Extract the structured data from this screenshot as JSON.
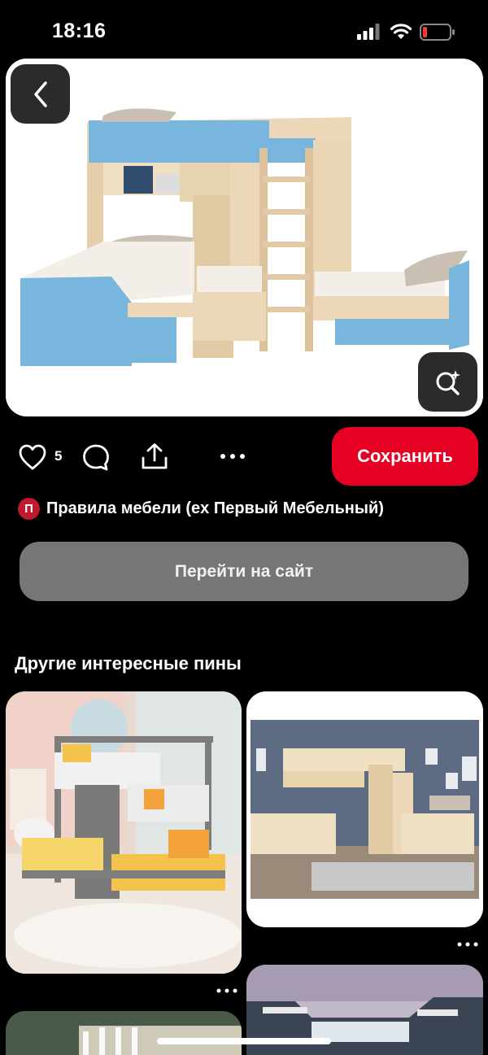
{
  "status_bar": {
    "time": "18:16"
  },
  "pin": {
    "image_icon": "bunk-bed-photo",
    "like_count": "5",
    "save_label": "Сохранить",
    "source_badge": "П",
    "source_name": "Правила мебели (ex Первый Мебельный)",
    "visit_label": "Перейти на сайт"
  },
  "related": {
    "title": "Другие интересные пины",
    "pins": [
      {
        "image": "grey-triple-bunk-bed-photo"
      },
      {
        "image": "wooden-l-shaped-bunk-bed-photo"
      },
      {
        "image": "crib-photo"
      },
      {
        "image": "dark-bunk-bed-photo"
      }
    ]
  },
  "colors": {
    "accent": "#e60023",
    "visit_button": "#767676",
    "bunk_blue": "#79b6de",
    "wood": "#ecd8b8"
  }
}
